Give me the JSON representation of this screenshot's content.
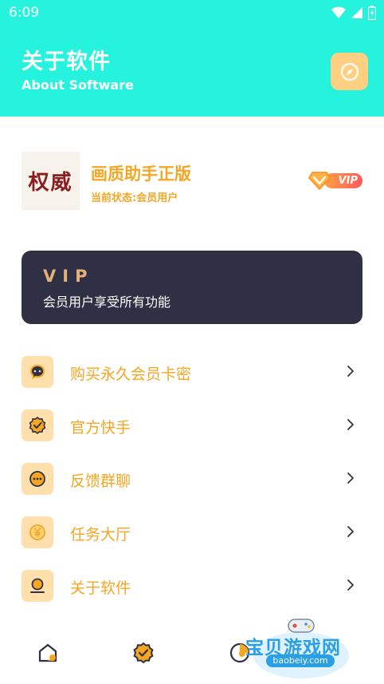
{
  "status_bar": {
    "time": "6:09",
    "icons": [
      "wifi-icon",
      "signal-icon",
      "battery-icon"
    ]
  },
  "header": {
    "title": "关于软件",
    "subtitle": "About Software",
    "action_icon": "compass-icon",
    "background": "#26f3dd"
  },
  "app_info": {
    "logo_text": "权威",
    "name": "画质助手正版",
    "status": "当前状态:会员用户",
    "badge_label": "VIP"
  },
  "vip_card": {
    "title": "VIP",
    "subtitle": "会员用户享受所有功能"
  },
  "menu": {
    "items": [
      {
        "label": "购买永久会员卡密",
        "icon": "chat-icon"
      },
      {
        "label": "官方快手",
        "icon": "badge-check-icon"
      },
      {
        "label": "反馈群聊",
        "icon": "message-dots-icon"
      },
      {
        "label": "任务大厅",
        "icon": "yen-coin-icon"
      },
      {
        "label": "关于软件",
        "icon": "user-info-icon"
      }
    ]
  },
  "tabbar": {
    "tabs": [
      {
        "icon": "home-icon"
      },
      {
        "icon": "badge-icon"
      },
      {
        "icon": "stats-icon"
      }
    ]
  },
  "watermark": {
    "text": "宝贝游戏网",
    "url": "baobeiy.com"
  },
  "colors": {
    "accent": "#f5a623",
    "header": "#26f3dd",
    "card": "#2f3044",
    "icon_bg": "#ffe0ad"
  }
}
